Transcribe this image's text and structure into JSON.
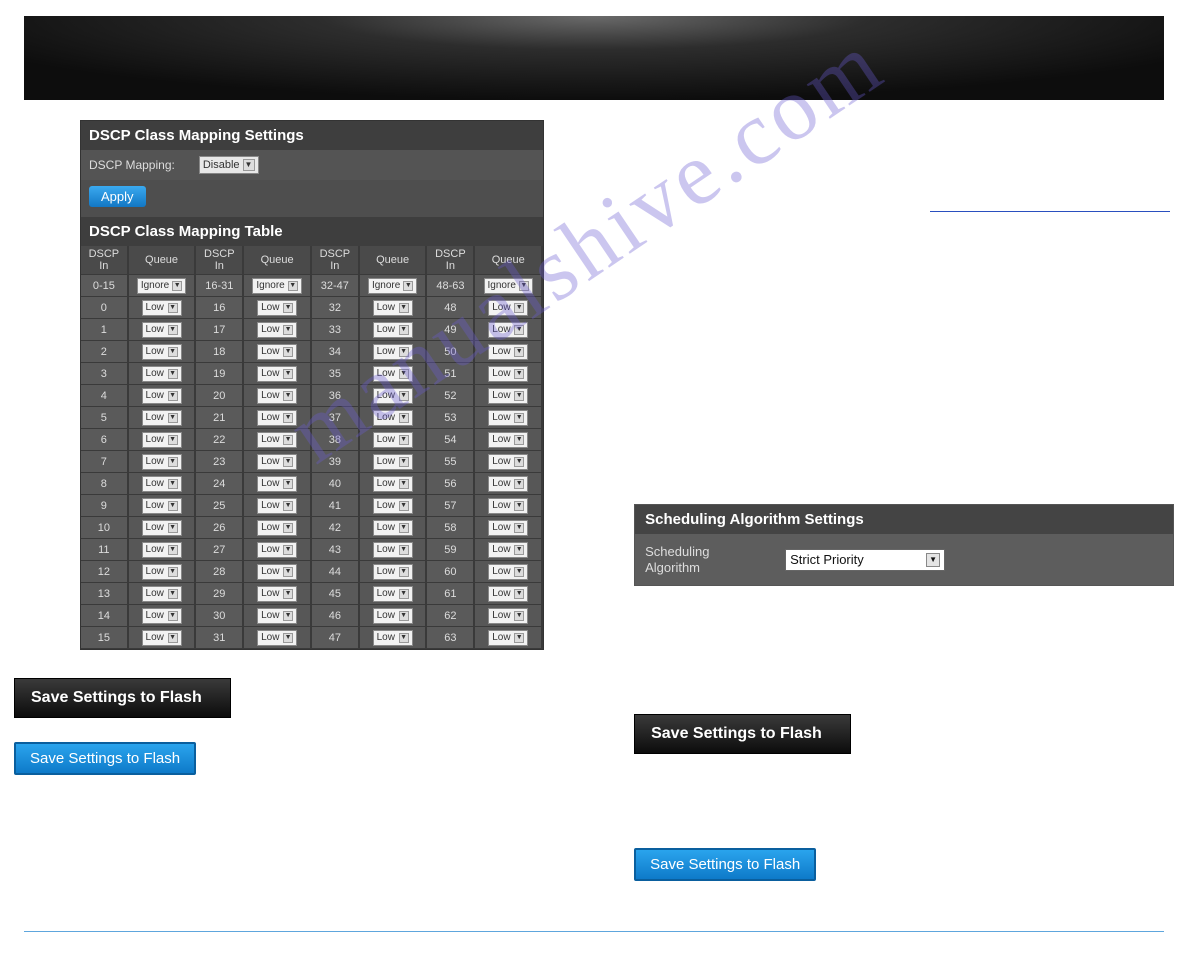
{
  "watermark": "manualshive.com",
  "left": {
    "panel_title": "DSCP Class Mapping Settings",
    "mapping_label": "DSCP Mapping:",
    "mapping_value": "Disable",
    "apply": "Apply",
    "table_title": "DSCP Class Mapping Table",
    "headers": {
      "dscp_in": "DSCP",
      "in": "In",
      "queue": "Queue"
    },
    "range_row": {
      "c0": "0-15",
      "q0": "Ignore",
      "c1": "16-31",
      "q1": "Ignore",
      "c2": "32-47",
      "q2": "Ignore",
      "c3": "48-63",
      "q3": "Ignore"
    },
    "rows": [
      {
        "c0": "0",
        "q0": "Low",
        "c1": "16",
        "q1": "Low",
        "c2": "32",
        "q2": "Low",
        "c3": "48",
        "q3": "Low"
      },
      {
        "c0": "1",
        "q0": "Low",
        "c1": "17",
        "q1": "Low",
        "c2": "33",
        "q2": "Low",
        "c3": "49",
        "q3": "Low"
      },
      {
        "c0": "2",
        "q0": "Low",
        "c1": "18",
        "q1": "Low",
        "c2": "34",
        "q2": "Low",
        "c3": "50",
        "q3": "Low"
      },
      {
        "c0": "3",
        "q0": "Low",
        "c1": "19",
        "q1": "Low",
        "c2": "35",
        "q2": "Low",
        "c3": "51",
        "q3": "Low"
      },
      {
        "c0": "4",
        "q0": "Low",
        "c1": "20",
        "q1": "Low",
        "c2": "36",
        "q2": "Low",
        "c3": "52",
        "q3": "Low"
      },
      {
        "c0": "5",
        "q0": "Low",
        "c1": "21",
        "q1": "Low",
        "c2": "37",
        "q2": "Low",
        "c3": "53",
        "q3": "Low"
      },
      {
        "c0": "6",
        "q0": "Low",
        "c1": "22",
        "q1": "Low",
        "c2": "38",
        "q2": "Low",
        "c3": "54",
        "q3": "Low"
      },
      {
        "c0": "7",
        "q0": "Low",
        "c1": "23",
        "q1": "Low",
        "c2": "39",
        "q2": "Low",
        "c3": "55",
        "q3": "Low"
      },
      {
        "c0": "8",
        "q0": "Low",
        "c1": "24",
        "q1": "Low",
        "c2": "40",
        "q2": "Low",
        "c3": "56",
        "q3": "Low"
      },
      {
        "c0": "9",
        "q0": "Low",
        "c1": "25",
        "q1": "Low",
        "c2": "41",
        "q2": "Low",
        "c3": "57",
        "q3": "Low"
      },
      {
        "c0": "10",
        "q0": "Low",
        "c1": "26",
        "q1": "Low",
        "c2": "42",
        "q2": "Low",
        "c3": "58",
        "q3": "Low"
      },
      {
        "c0": "11",
        "q0": "Low",
        "c1": "27",
        "q1": "Low",
        "c2": "43",
        "q2": "Low",
        "c3": "59",
        "q3": "Low"
      },
      {
        "c0": "12",
        "q0": "Low",
        "c1": "28",
        "q1": "Low",
        "c2": "44",
        "q2": "Low",
        "c3": "60",
        "q3": "Low"
      },
      {
        "c0": "13",
        "q0": "Low",
        "c1": "29",
        "q1": "Low",
        "c2": "45",
        "q2": "Low",
        "c3": "61",
        "q3": "Low"
      },
      {
        "c0": "14",
        "q0": "Low",
        "c1": "30",
        "q1": "Low",
        "c2": "46",
        "q2": "Low",
        "c3": "62",
        "q3": "Low"
      },
      {
        "c0": "15",
        "q0": "Low",
        "c1": "31",
        "q1": "Low",
        "c2": "47",
        "q2": "Low",
        "c3": "63",
        "q3": "Low"
      }
    ],
    "save_black": "Save Settings to Flash",
    "save_blue": "Save Settings to Flash"
  },
  "right": {
    "link_placeholder": "",
    "sched_title": "Scheduling Algorithm Settings",
    "sched_label_1": "Scheduling",
    "sched_label_2": "Algorithm",
    "sched_value": "Strict Priority",
    "save_black": "Save Settings to Flash",
    "save_blue": "Save Settings to Flash"
  }
}
